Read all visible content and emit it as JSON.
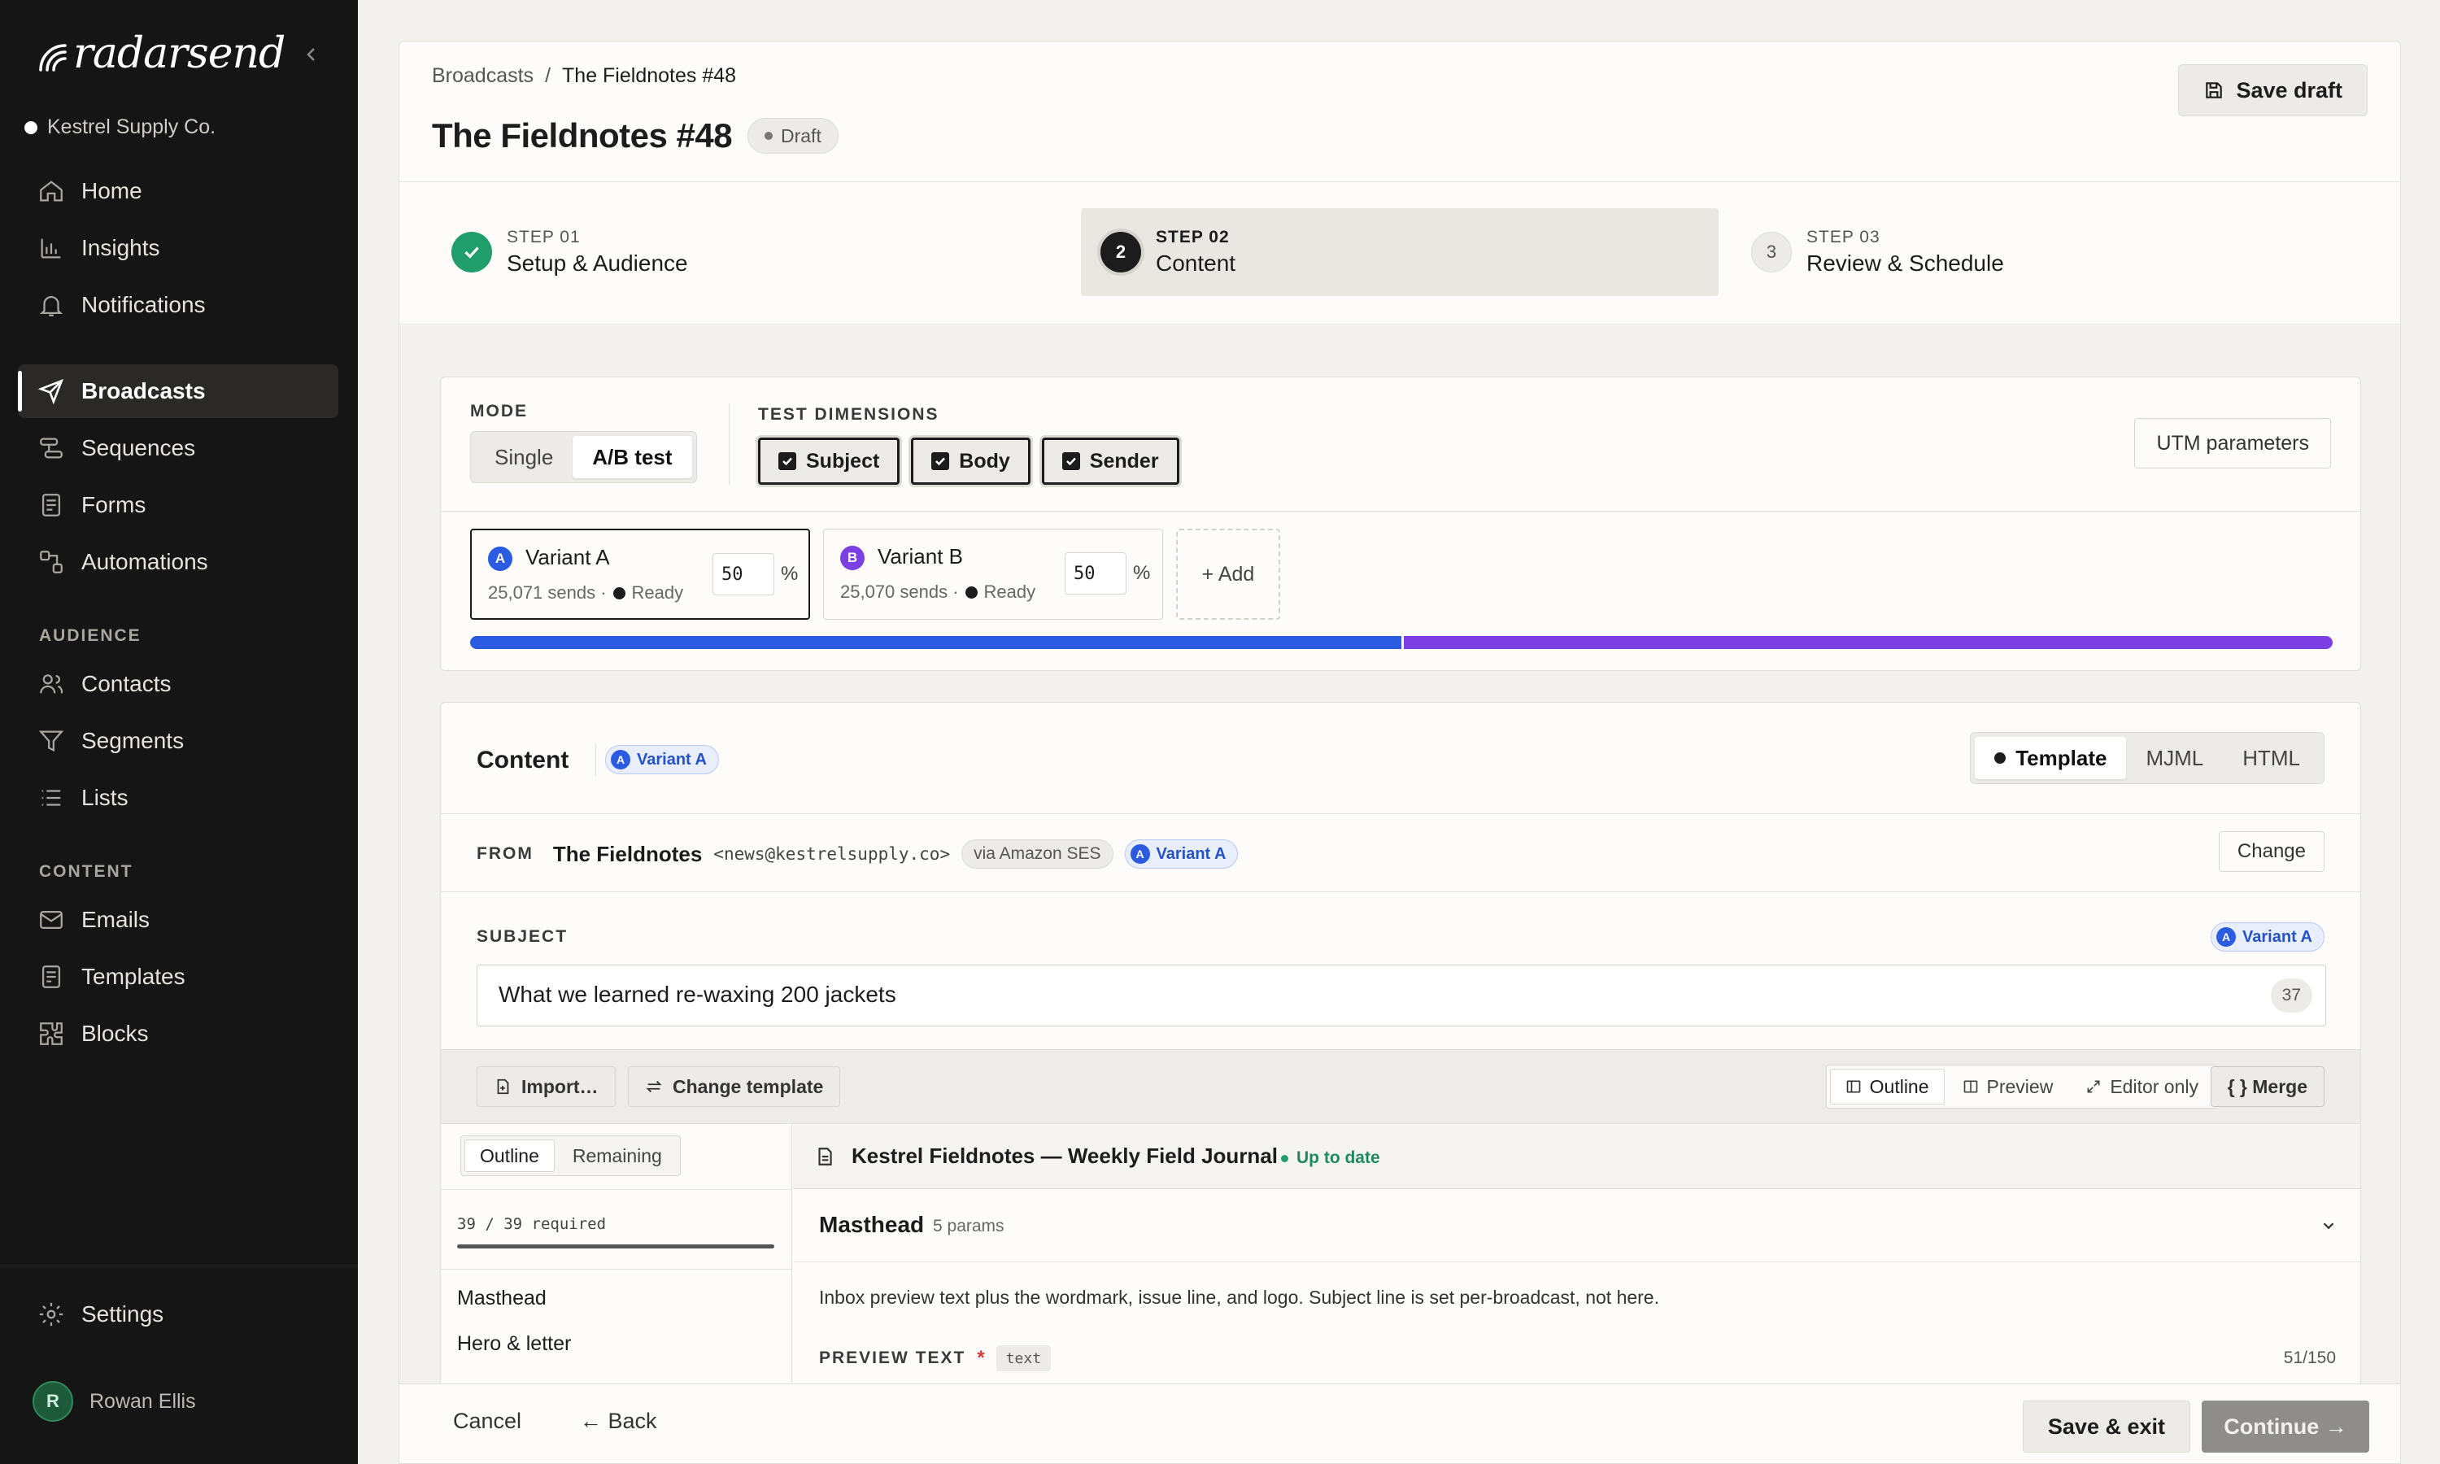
{
  "app": {
    "name": "radarsend",
    "workspace": "Kestrel Supply Co."
  },
  "nav": {
    "main": [
      {
        "label": "Home",
        "icon": "home-icon"
      },
      {
        "label": "Insights",
        "icon": "bar-chart-icon"
      },
      {
        "label": "Notifications",
        "icon": "bell-icon"
      }
    ],
    "broadcasting": [
      {
        "label": "Broadcasts",
        "icon": "send-icon",
        "active": true
      },
      {
        "label": "Sequences",
        "icon": "sequence-icon"
      },
      {
        "label": "Forms",
        "icon": "form-icon"
      },
      {
        "label": "Automations",
        "icon": "automation-icon"
      }
    ],
    "audience_title": "AUDIENCE",
    "audience": [
      {
        "label": "Contacts",
        "icon": "contacts-icon"
      },
      {
        "label": "Segments",
        "icon": "filter-icon"
      },
      {
        "label": "Lists",
        "icon": "list-icon"
      }
    ],
    "content_title": "CONTENT",
    "content": [
      {
        "label": "Emails",
        "icon": "mail-icon"
      },
      {
        "label": "Templates",
        "icon": "template-icon"
      },
      {
        "label": "Blocks",
        "icon": "blocks-icon"
      }
    ],
    "settings": "Settings"
  },
  "user": {
    "initial": "R",
    "name": "Rowan Ellis"
  },
  "breadcrumb": {
    "parent": "Broadcasts",
    "sep": "/",
    "current": "The Fieldnotes #48"
  },
  "page": {
    "title": "The Fieldnotes #48",
    "status": "Draft",
    "save_draft": "Save draft"
  },
  "steps": [
    {
      "num": "✓",
      "label": "STEP 01",
      "name": "Setup & Audience",
      "state": "done"
    },
    {
      "num": "2",
      "label": "STEP 02",
      "name": "Content",
      "state": "current"
    },
    {
      "num": "3",
      "label": "STEP 03",
      "name": "Review & Schedule",
      "state": "upcoming"
    }
  ],
  "mode": {
    "label": "MODE",
    "options": [
      "Single",
      "A/B test"
    ],
    "selected": "A/B test",
    "dims_label": "TEST DIMENSIONS",
    "dims": [
      "Subject",
      "Body",
      "Sender"
    ],
    "utm": "UTM parameters"
  },
  "variants": [
    {
      "badge": "A",
      "name": "Variant A",
      "sends": "25,071 sends ·",
      "status": "Ready",
      "pct": "50",
      "color": "#2a5be0"
    },
    {
      "badge": "B",
      "name": "Variant B",
      "sends": "25,070 sends ·",
      "status": "Ready",
      "pct": "50",
      "color": "#7b3fe4"
    }
  ],
  "variant_add": "+ Add",
  "split": {
    "a_fraction": 0.5,
    "a_color": "#2a5be0",
    "b_color": "#7b3fe4"
  },
  "content": {
    "title": "Content",
    "variant": "Variant A",
    "variant_badge": "A",
    "format_tabs": [
      "Template",
      "MJML",
      "HTML"
    ],
    "format_selected": "Template",
    "from_label": "FROM",
    "from_name": "The Fieldnotes",
    "from_email": "<news@kestrelsupply.co>",
    "via": "via Amazon SES",
    "change": "Change",
    "subject_label": "SUBJECT",
    "subject": "What we learned re-waxing 200 jackets",
    "subject_count": "37",
    "import": "Import…",
    "change_template": "Change template",
    "view_tabs": [
      "Outline",
      "Preview",
      "Editor only"
    ],
    "merge": "{ } Merge"
  },
  "outline": {
    "tabs": [
      "Outline",
      "Remaining"
    ],
    "progress": "39 / 39 required",
    "progress_fraction": 1.0,
    "items": [
      "Masthead",
      "Hero & letter"
    ]
  },
  "template": {
    "name": "Kestrel Fieldnotes — Weekly Field Journal",
    "status": "Up to date",
    "section": "Masthead",
    "params": "5 params",
    "desc": "Inbox preview text plus the wordmark, issue line, and logo. Subject line is set per-broadcast, not here.",
    "field_label": "PREVIEW TEXT",
    "field_required": "*",
    "field_type": "text",
    "field_count": "51/150"
  },
  "footer": {
    "cancel": "Cancel",
    "back": "← Back",
    "save_exit": "Save & exit",
    "continue": "Continue →"
  }
}
